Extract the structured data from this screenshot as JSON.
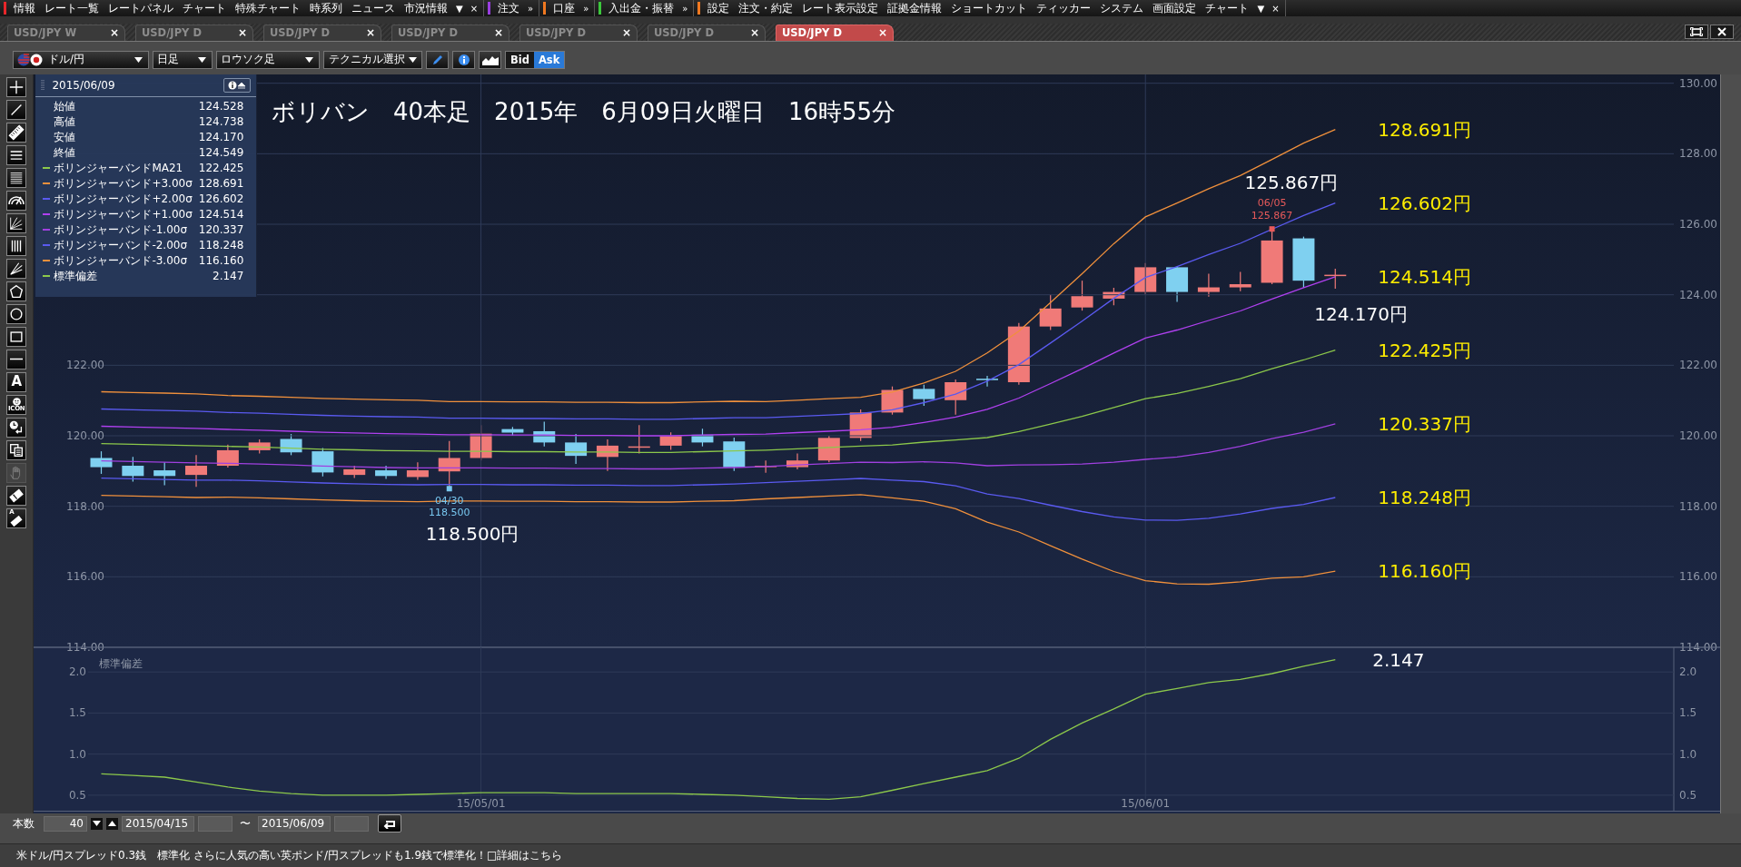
{
  "menu_bar": {
    "groups": [
      {
        "color": "#e8262a",
        "items": [
          "情報",
          "レート一覧",
          "レートパネル",
          "チャート",
          "特殊チャート",
          "時系列",
          "ニュース",
          "市況情報"
        ],
        "trailing": [
          "▼",
          "×"
        ]
      },
      {
        "color": "#9a3ee0",
        "items": [
          "注文"
        ],
        "trailing": [
          "»"
        ]
      },
      {
        "color": "#f07820",
        "items": [
          "口座"
        ],
        "trailing": [
          "»"
        ]
      },
      {
        "color": "#3cc83c",
        "items": [
          "入出金・振替"
        ],
        "trailing": [
          "»"
        ]
      },
      {
        "color": "#f07820",
        "items": [
          "設定",
          "注文・約定",
          "レート表示設定",
          "証拠金情報",
          "ショートカット",
          "ティッカー",
          "システム",
          "画面設定",
          "チャート"
        ],
        "trailing": [
          "▼",
          "×"
        ]
      }
    ]
  },
  "tabs": [
    {
      "label": "USD/JPY W",
      "close": "×",
      "selected": false
    },
    {
      "label": "USD/JPY D",
      "close": "×",
      "selected": false
    },
    {
      "label": "USD/JPY D",
      "close": "×",
      "selected": false
    },
    {
      "label": "USD/JPY D",
      "close": "×",
      "selected": false
    },
    {
      "label": "USD/JPY D",
      "close": "×",
      "selected": false
    },
    {
      "label": "USD/JPY D",
      "close": "×",
      "selected": false
    },
    {
      "label": "USD/JPY D",
      "close": "×",
      "selected": true
    }
  ],
  "toolbar": {
    "pair": "ドル/円",
    "timeframe": "日足",
    "chart_type": "ロウソク足",
    "technical_button": "テクニカル選択",
    "tool_buttons": [
      {
        "kind": "pencil"
      },
      {
        "kind": "info"
      },
      {
        "kind": "mountain"
      }
    ],
    "price_toggle": [
      {
        "label": "Bid",
        "selected": false
      },
      {
        "label": "Ask",
        "selected": true
      }
    ]
  },
  "left_tools": [
    {
      "kind": "crosshair",
      "disabled": false
    },
    {
      "kind": "line",
      "disabled": false
    },
    {
      "kind": "ruler",
      "disabled": false
    },
    {
      "kind": "lines3",
      "disabled": false
    },
    {
      "kind": "lines6",
      "disabled": false
    },
    {
      "kind": "gauge",
      "disabled": false
    },
    {
      "kind": "fan-axes",
      "disabled": false
    },
    {
      "kind": "vlines",
      "disabled": false
    },
    {
      "kind": "fan",
      "disabled": false
    },
    {
      "kind": "pentagon",
      "disabled": false
    },
    {
      "kind": "circle",
      "disabled": false
    },
    {
      "kind": "rectangle",
      "disabled": false
    },
    {
      "kind": "hline",
      "disabled": false
    },
    {
      "kind": "text",
      "label": "A",
      "disabled": false
    },
    {
      "kind": "stamp",
      "label": "ICON",
      "disabled": false
    },
    {
      "kind": "clock",
      "disabled": false
    },
    {
      "kind": "copy",
      "disabled": false
    },
    {
      "kind": "hand",
      "disabled": true
    },
    {
      "kind": "eraser",
      "disabled": false
    },
    {
      "kind": "text-eraser",
      "label": "A",
      "disabled": false
    }
  ],
  "info_panel": {
    "date": "2015/06/09",
    "ohlc_rows": [
      {
        "label": "始値",
        "value": "124.528"
      },
      {
        "label": "高値",
        "value": "124.738"
      },
      {
        "label": "安値",
        "value": "124.170"
      },
      {
        "label": "終値",
        "value": "124.549"
      }
    ],
    "band_values": [
      "122.425",
      "128.691",
      "126.602",
      "124.514",
      "120.337",
      "118.248",
      "116.160"
    ],
    "indicator_values": [
      "2.147"
    ]
  },
  "chart": {
    "chart_data": {
      "type": "line",
      "title": "ボリバン　40本足　2015年　6月09日火曜日　16時55分",
      "ylim": [
        114,
        130
      ],
      "grid": true,
      "yticks": [
        {
          "value": 130,
          "label": "130.00"
        },
        {
          "value": 128,
          "label": "128.00"
        },
        {
          "value": 126,
          "label": "126.00"
        },
        {
          "value": 124,
          "label": "124.00"
        },
        {
          "value": 122,
          "label": "122.00"
        },
        {
          "value": 120,
          "label": "120.00"
        },
        {
          "value": 118,
          "label": "118.00"
        },
        {
          "value": 116,
          "label": "116.00"
        },
        {
          "value": 114,
          "label": "114.00"
        }
      ],
      "series": [
        {
          "name": "ボリンジャーバンドMA21",
          "color": "#8cc84b",
          "values": [
            119.78,
            119.76,
            119.74,
            119.72,
            119.7,
            119.68,
            119.65,
            119.62,
            119.6,
            119.58,
            119.57,
            119.56,
            119.56,
            119.55,
            119.55,
            119.54,
            119.54,
            119.53,
            119.53,
            119.55,
            119.57,
            119.59,
            119.63,
            119.67,
            119.71,
            119.74,
            119.82,
            119.88,
            119.95,
            120.12,
            120.33,
            120.55,
            120.8,
            121.05,
            121.2,
            121.4,
            121.62,
            121.9,
            122.15,
            122.43
          ]
        },
        {
          "name": "ボリンジャーバンド+3.00σ",
          "color": "#f0903c",
          "values": [
            121.25,
            121.23,
            121.21,
            121.19,
            121.14,
            121.12,
            121.09,
            121.06,
            121.04,
            121.02,
            121.01,
            120.97,
            120.97,
            120.96,
            120.96,
            120.95,
            120.95,
            120.94,
            120.94,
            120.96,
            120.98,
            120.97,
            121.01,
            121.05,
            121.09,
            121.24,
            121.5,
            121.83,
            122.35,
            122.97,
            123.78,
            124.6,
            125.45,
            126.21,
            126.6,
            127.01,
            127.38,
            127.84,
            128.3,
            128.69
          ]
        },
        {
          "name": "ボリンジャーバンド+2.00σ",
          "color": "#5a5af0",
          "values": [
            120.76,
            120.74,
            120.72,
            120.7,
            120.66,
            120.64,
            120.61,
            120.58,
            120.56,
            120.54,
            120.53,
            120.5,
            120.5,
            120.49,
            120.49,
            120.48,
            120.48,
            120.47,
            120.47,
            120.49,
            120.51,
            120.51,
            120.55,
            120.59,
            120.63,
            120.74,
            120.94,
            121.18,
            121.55,
            122.02,
            122.63,
            123.25,
            123.9,
            124.49,
            124.8,
            125.14,
            125.46,
            125.86,
            126.25,
            126.6
          ]
        },
        {
          "name": "ボリンジャーバンド+1.00σ",
          "color": "#b040f0",
          "values": [
            120.27,
            120.25,
            120.23,
            120.21,
            120.18,
            120.16,
            120.13,
            120.1,
            120.08,
            120.06,
            120.05,
            120.03,
            120.03,
            120.02,
            120.02,
            120.01,
            120.01,
            120.0,
            120.0,
            120.02,
            120.04,
            120.05,
            120.09,
            120.13,
            120.17,
            120.24,
            120.38,
            120.53,
            120.75,
            121.07,
            121.48,
            121.9,
            122.35,
            122.77,
            123.0,
            123.27,
            123.54,
            123.88,
            124.2,
            124.51
          ]
        },
        {
          "name": "ボリンジャーバンド-1.00σ",
          "color": "#a040e0",
          "values": [
            119.29,
            119.27,
            119.25,
            119.23,
            119.22,
            119.2,
            119.17,
            119.14,
            119.12,
            119.1,
            119.09,
            119.09,
            119.09,
            119.08,
            119.08,
            119.07,
            119.07,
            119.06,
            119.06,
            119.08,
            119.1,
            119.13,
            119.17,
            119.21,
            119.25,
            119.24,
            119.26,
            119.23,
            119.15,
            119.17,
            119.18,
            119.2,
            119.25,
            119.33,
            119.4,
            119.53,
            119.7,
            119.92,
            120.1,
            120.34
          ]
        },
        {
          "name": "ボリンジャーバンド-2.00σ",
          "color": "#5a5af0",
          "values": [
            118.8,
            118.78,
            118.76,
            118.74,
            118.74,
            118.72,
            118.69,
            118.66,
            118.64,
            118.62,
            118.61,
            118.62,
            118.62,
            118.61,
            118.61,
            118.6,
            118.6,
            118.59,
            118.59,
            118.61,
            118.63,
            118.67,
            118.71,
            118.75,
            118.79,
            118.74,
            118.7,
            118.58,
            118.35,
            118.22,
            118.03,
            117.85,
            117.7,
            117.61,
            117.6,
            117.66,
            117.78,
            117.94,
            118.05,
            118.25
          ]
        },
        {
          "name": "ボリンジャーバンド-3.00σ",
          "color": "#f0903c",
          "values": [
            118.31,
            118.29,
            118.27,
            118.25,
            118.26,
            118.24,
            118.21,
            118.18,
            118.16,
            118.14,
            118.13,
            118.15,
            118.15,
            118.14,
            118.14,
            118.13,
            118.13,
            118.12,
            118.12,
            118.14,
            118.16,
            118.21,
            118.25,
            118.29,
            118.33,
            118.24,
            118.14,
            117.93,
            117.55,
            117.27,
            116.88,
            116.5,
            116.15,
            115.89,
            115.8,
            115.79,
            115.86,
            115.96,
            116.0,
            116.16
          ]
        }
      ],
      "annotations": [
        "128.691円",
        "126.602円",
        "124.514円",
        "122.425円",
        "120.337円",
        "118.248円",
        "116.160円",
        "125.867円",
        "124.170円",
        "118.500円"
      ]
    },
    "extreme_markers": [
      {
        "high": true,
        "date": "06/05",
        "price": "125.867",
        "color": "#e85a5a"
      },
      {
        "high": false,
        "date": "04/30",
        "price": "118.500",
        "color": "#78c8f0"
      }
    ]
  },
  "indicator_chart": {
    "chart_data": {
      "type": "line",
      "categories": [
        null,
        null,
        null,
        null,
        null,
        null,
        null,
        null,
        null,
        null,
        null,
        null,
        "15/05/01",
        null,
        null,
        null,
        null,
        null,
        null,
        null,
        null,
        null,
        null,
        null,
        null,
        null,
        null,
        null,
        null,
        null,
        null,
        null,
        null,
        "15/06/01",
        null,
        null,
        null,
        null,
        null,
        null
      ],
      "grid": true,
      "ylim": [
        0.3,
        2.3
      ],
      "yticks": [
        {
          "value": 2,
          "label": "2.0"
        },
        {
          "value": 1.5,
          "label": "1.5"
        },
        {
          "value": 1,
          "label": "1.0"
        },
        {
          "value": 0.5,
          "label": "0.5"
        }
      ],
      "series": [
        {
          "name": "標準偏差",
          "color": "#8cc84b",
          "values": [
            0.76,
            0.74,
            0.72,
            0.66,
            0.6,
            0.55,
            0.52,
            0.5,
            0.5,
            0.5,
            0.51,
            0.52,
            0.53,
            0.53,
            0.53,
            0.52,
            0.52,
            0.52,
            0.52,
            0.51,
            0.5,
            0.48,
            0.46,
            0.45,
            0.48,
            0.56,
            0.64,
            0.72,
            0.8,
            0.95,
            1.18,
            1.38,
            1.55,
            1.73,
            1.8,
            1.87,
            1.91,
            1.98,
            2.07,
            2.15
          ]
        }
      ],
      "annotations": [
        "2.147"
      ]
    }
  },
  "bottom_bar": {
    "count_label": "本数",
    "count": "40",
    "from_date": "2015/04/15",
    "range_separator": "〜",
    "to_date": "2015/06/09"
  },
  "ticker": {
    "text": "米ドル/円スプレッド0.3銭　標準化 さらに人気の高い英ポンド/円スプレッドも1.9銭で標準化！□詳細はこちら"
  }
}
